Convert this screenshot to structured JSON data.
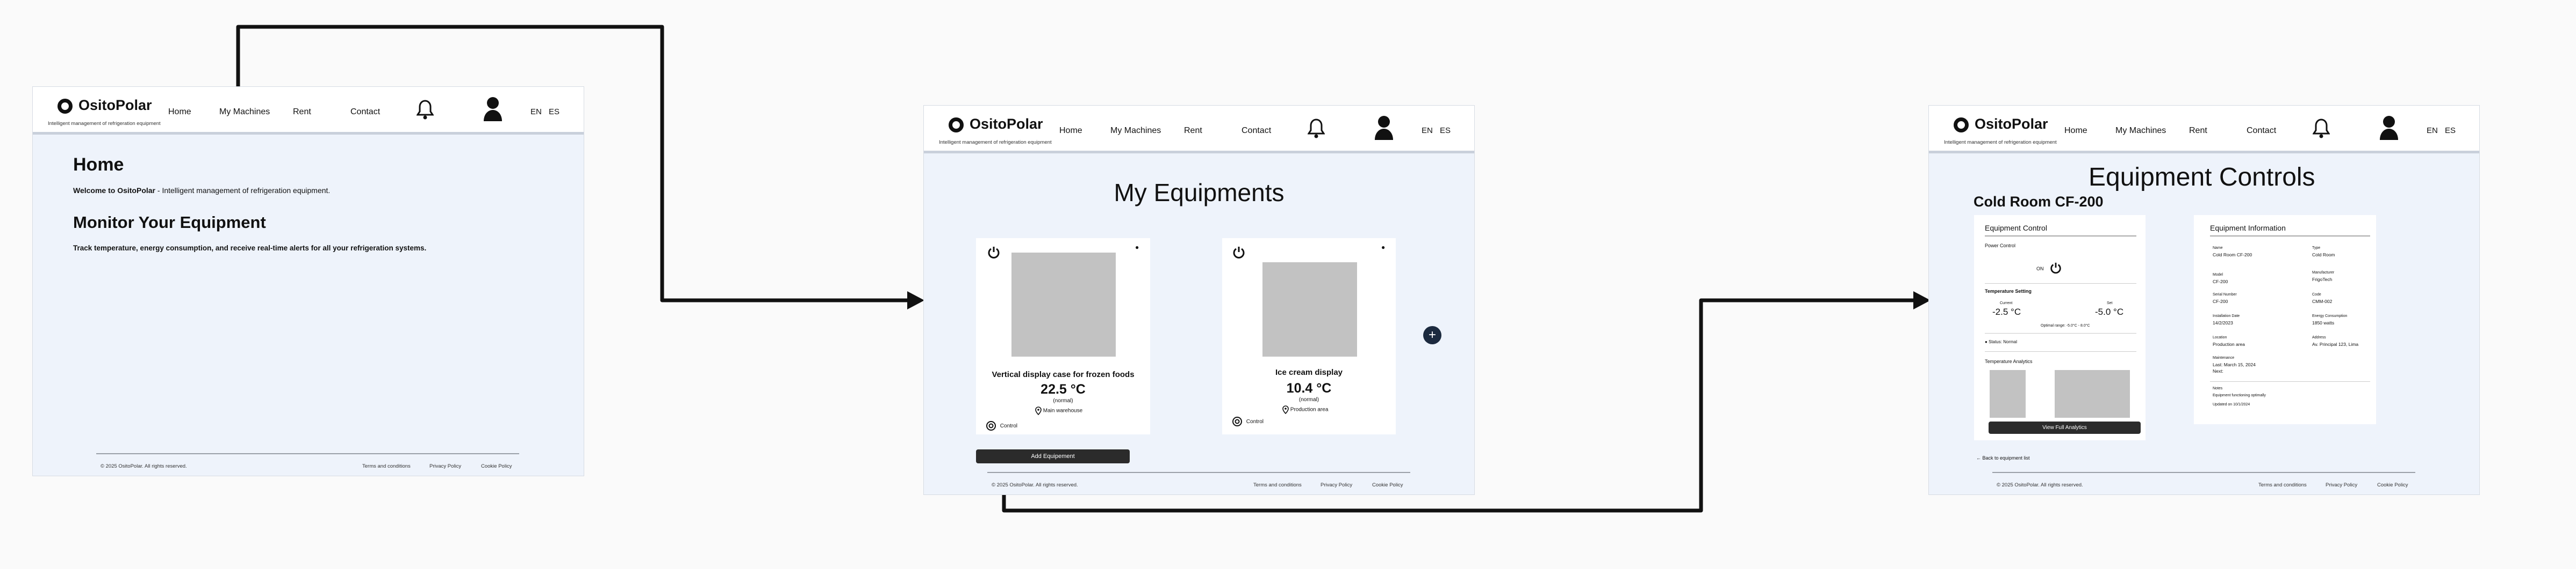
{
  "common": {
    "brand": "OsitoPolar",
    "tagline": "Intelligent management of refrigeration equipment",
    "nav": [
      "Home",
      "My Machines",
      "Rent",
      "Contact"
    ],
    "lang": [
      "EN",
      "ES"
    ],
    "footer": {
      "copyright": "© 2025 OsitoPolar. All rights reserved.",
      "terms": "Terms and conditions",
      "privacy": "Privacy Policy",
      "cookies": "Cookie Policy"
    }
  },
  "home": {
    "title": "Home",
    "welcome_bold": "Welcome to OsitoPolar",
    "welcome_rest": " - Intelligent management of refrigeration equipment.",
    "monitor_title": "Monitor Your Equipment",
    "monitor_text": "Track temperature, energy consumption, and receive real-time alerts for all your refrigeration systems."
  },
  "equipments": {
    "title": "My Equipments",
    "cards": [
      {
        "name": "Vertical display case for frozen foods",
        "temp": "22.5 °C",
        "status": "(normal)",
        "location": "Main warehouse",
        "control": "Control"
      },
      {
        "name": "Ice cream display",
        "temp": "10.4 °C",
        "status": "(normal)",
        "location": "Production area",
        "control": "Control"
      }
    ],
    "add_button": "Add Equipement",
    "add_icon": "+"
  },
  "controls": {
    "title": "Equipment Controls",
    "subtitle": "Cold Room CF-200",
    "control_panel": {
      "heading": "Equipment Control",
      "power_label": "Power Control",
      "power_state": "ON",
      "temp_heading": "Temperature Setting",
      "current_label": "Current",
      "current_value": "-2.5 °C",
      "set_label": "Set",
      "set_value": "-5.0 °C",
      "optimal": "Optimal range: -5.0°C - 8.0°C",
      "status": "Status: Normal",
      "analytics_heading": "Temperature Analytics",
      "analytics_button": "View Full Analytics"
    },
    "info_panel": {
      "heading": "Equipment Information",
      "fields": [
        {
          "label": "Name",
          "value": "Cold Room CF-200"
        },
        {
          "label": "Type",
          "value": "Cold Room"
        },
        {
          "label": "Model",
          "value": "CF-200"
        },
        {
          "label": "Manufacturer",
          "value": "FrigoTech"
        },
        {
          "label": "Serial Number",
          "value": "CF-200"
        },
        {
          "label": "Code",
          "value": "CMM-002"
        },
        {
          "label": "Installation Date",
          "value": "14/2/2023"
        },
        {
          "label": "Energy Consumption",
          "value": "1850 watts"
        },
        {
          "label": "Location",
          "value": "Production area"
        },
        {
          "label": "Address",
          "value": "Av. Principal 123, Lima"
        },
        {
          "label": "Maintenance",
          "value": "Last: March 15, 2024"
        },
        {
          "label": "",
          "value": "Next:"
        },
        {
          "label": "Notes",
          "value": "Equipment functioning optimally"
        },
        {
          "label": "",
          "value": "Updated on 10/1/2024"
        }
      ]
    },
    "back_link": "← Back to equipment list"
  }
}
